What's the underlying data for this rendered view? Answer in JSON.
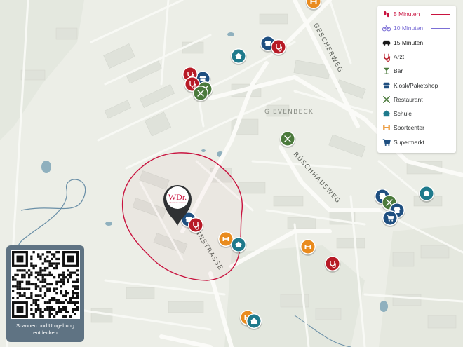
{
  "legend": {
    "time": [
      {
        "label": "5 Minuten",
        "color": "#c9133f",
        "icon": "walking-icon"
      },
      {
        "label": "10 Minuten",
        "color": "#7b6fd6",
        "icon": "bicycle-icon"
      },
      {
        "label": "15 Minuten",
        "color": "#1a1a1a",
        "icon": "car-icon"
      }
    ],
    "categories": [
      {
        "label": "Arzt",
        "color": "#b71a26",
        "icon": "stethoscope-icon"
      },
      {
        "label": "Bar",
        "color": "#4b7a3c",
        "icon": "cocktail-icon"
      },
      {
        "label": "Kiosk/Paketshop",
        "color": "#1f4f80",
        "icon": "shop-icon"
      },
      {
        "label": "Restaurant",
        "color": "#4b7a3c",
        "icon": "cutlery-icon"
      },
      {
        "label": "Schule",
        "color": "#1f7a8c",
        "icon": "school-icon"
      },
      {
        "label": "Sportcenter",
        "color": "#e98b1e",
        "icon": "sport-icon"
      },
      {
        "label": "Supermarkt",
        "color": "#1f4f80",
        "icon": "cart-icon"
      }
    ]
  },
  "map": {
    "street_labels": {
      "gescherweg": "GESCHERWEG",
      "gievenbeck": "GIEVENBECK",
      "ruschhausweg": "RÜSCHHAUSWEG",
      "strasse": "NNSTRASSE"
    },
    "logo": {
      "text": "WDr.",
      "subtext": "IMMOBILIEN SEIT 1900",
      "color": "#c9133f"
    }
  },
  "qr": {
    "text": "Scannen und Umgebung entdecken"
  }
}
